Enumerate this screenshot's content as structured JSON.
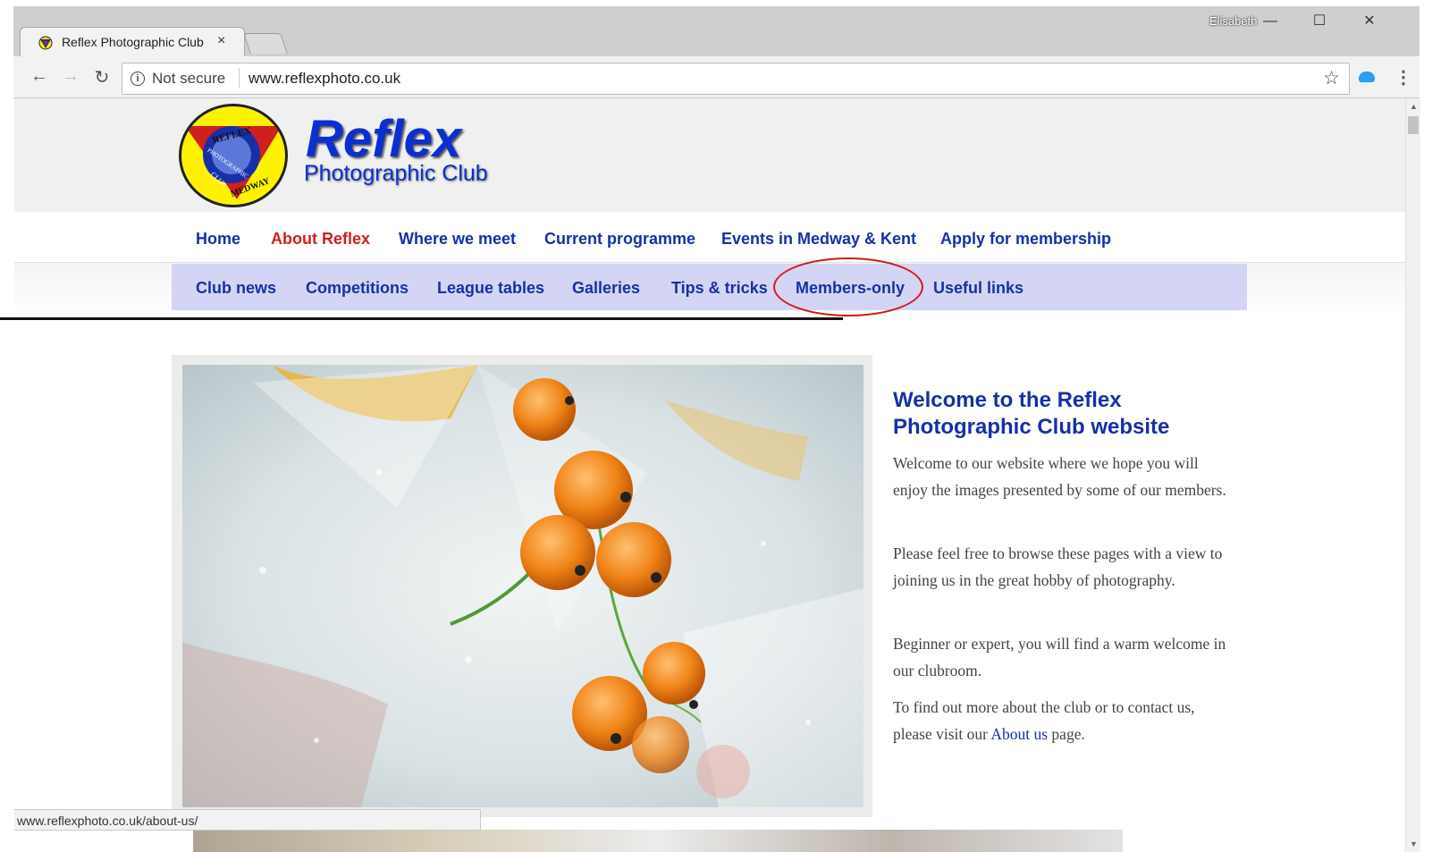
{
  "browser": {
    "tab_title": "Reflex Photographic Club",
    "tab_close": "×",
    "profile_name": "Elisabeth",
    "security_label": "Not secure",
    "url": "www.reflexphoto.co.uk",
    "status_url": "www.reflexphoto.co.uk/about-us/",
    "window_minimize": "—",
    "window_maximize": "☐",
    "window_close": "✕",
    "nav_back": "←",
    "nav_forward": "→",
    "nav_reload": "↻",
    "bookmark_star": "☆",
    "menu": "⋮"
  },
  "site": {
    "logo_title": "Reflex",
    "logo_subtitle": "Photographic Club",
    "logo_ring_text_top": "REFLEX",
    "logo_ring_text_left": "PHOTOGRAPHIC",
    "logo_ring_text_club": "CLUB",
    "logo_ring_text_bottom": "MEDWAY",
    "main_nav": [
      {
        "label": "Home",
        "active": false
      },
      {
        "label": "About Reflex",
        "active": true
      },
      {
        "label": "Where we meet",
        "active": false
      },
      {
        "label": "Current programme",
        "active": false
      },
      {
        "label": "Events in Medway & Kent",
        "active": false
      },
      {
        "label": "Apply for membership",
        "active": false
      }
    ],
    "sub_nav": [
      {
        "label": "Club news"
      },
      {
        "label": "Competitions"
      },
      {
        "label": "League tables"
      },
      {
        "label": "Galleries"
      },
      {
        "label": "Tips & tricks"
      },
      {
        "label": "Members-only"
      },
      {
        "label": "Useful links"
      }
    ],
    "welcome_title": "Welcome to the Reflex Photographic Club website",
    "paragraphs": [
      "Welcome to our website where we hope you will enjoy the images presented by some of our members.",
      "Please feel free to browse these pages with a view to joining us in the great hobby of photography.",
      "Beginner or expert, you will find a warm welcome in our clubroom."
    ],
    "contact_para_before": "To find out more about the club or to contact us, please visit our ",
    "contact_link": "About us",
    "contact_para_after": " page."
  },
  "colors": {
    "nav_blue": "#1630a8",
    "active_red": "#d01f1f",
    "subnav_bg": "#d4d4f4",
    "annotation_red": "#d61818"
  }
}
